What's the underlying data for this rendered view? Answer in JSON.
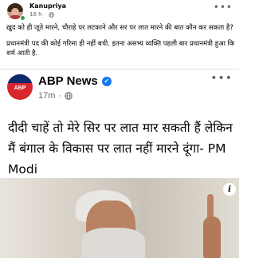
{
  "post": {
    "author": "Kanupriya",
    "timestamp": "18 h",
    "separator": "·",
    "text_line1": "ख़ुद को ही जूते मारने, चौराहे पर लटकाने और सर पर लात मारने की बात कौन कर सकता है?",
    "text_line2": "प्रधानमंत्री पद की कोई गरिमा ही नहीं बची. इतना असभ्य व्यक्ति पहली बार प्रधानमंत्री हुआ कि शर्म आती है."
  },
  "shared": {
    "logo_text": "ABP",
    "page_name": "ABP News",
    "timestamp": "17m",
    "separator": "·",
    "headline": "दीदी चाहें तो मेरे सिर पर लात मार सकती हैं लेकिन मैं बंगाल के विकास पर लात नहीं मारने दूंगा- PM Modi"
  },
  "icons": {
    "more": "more-options-icon",
    "globe": "globe-icon",
    "verified": "verified-badge-icon",
    "info": "info-icon",
    "online": "online-status-icon"
  },
  "colors": {
    "verified_blue": "#1877f2",
    "online_green": "#31a24c",
    "secondary_text": "#65676b",
    "abp_red": "#d8262e"
  }
}
